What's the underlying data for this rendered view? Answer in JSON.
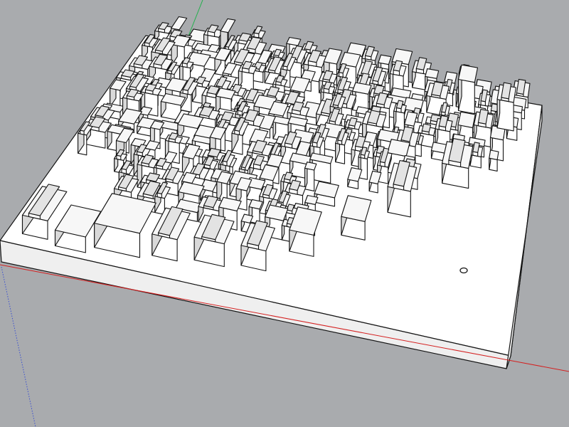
{
  "viewport": {
    "background_color": "#a9abae",
    "axis_colors": {
      "green_axis": "#22b14c",
      "red_axis": "#d42020",
      "blue_axis": "#3a4fd1"
    },
    "model_colors": {
      "block_face": "#ffffff",
      "block_side": "#efefef",
      "edge": "#141414",
      "roof_light": "#f7f7f7",
      "roof_shade": "#e3e3e3",
      "wall_shade": "#d9d9d9"
    }
  }
}
